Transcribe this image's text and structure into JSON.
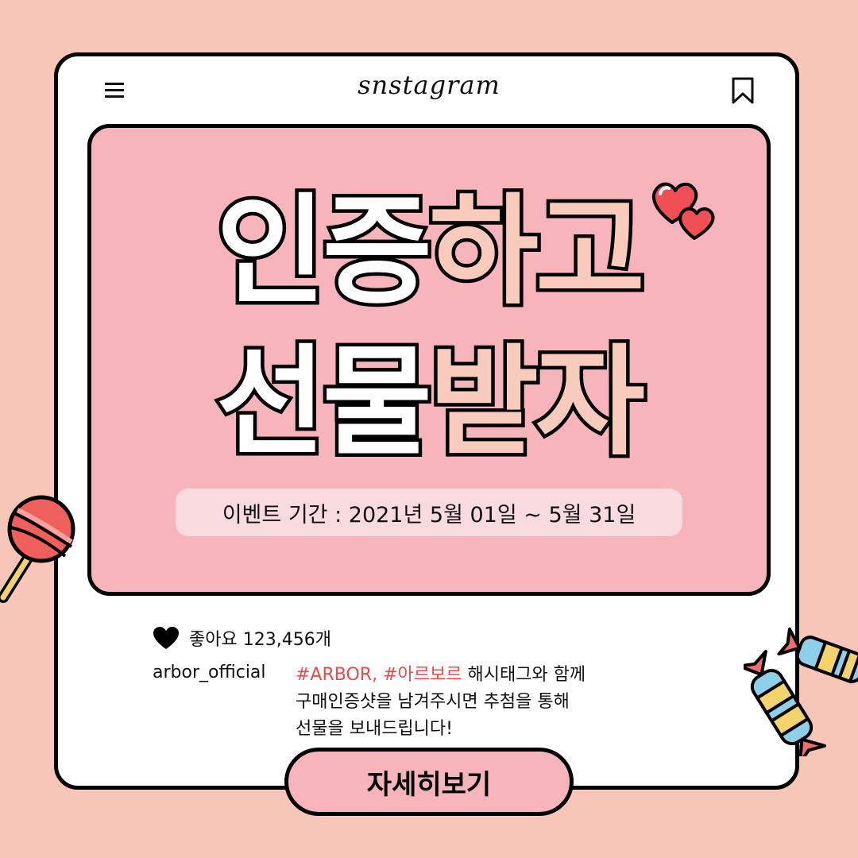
{
  "header": {
    "logo": "snstagram",
    "menu_icon": "hamburger-menu-icon",
    "bookmark_icon": "bookmark-icon"
  },
  "banner": {
    "line1_white": "인증",
    "line1_pink": "하고",
    "line2_white": "선물",
    "line2_pink": "받자",
    "period": "이벤트 기간 : 2021년 5월 01일 ~ 5월 31일"
  },
  "post": {
    "likes": "좋아요 123,456개",
    "username": "arbor_official",
    "caption_tags": "#ARBOR, #아르보르",
    "caption_line1_rest": " 해시태그와 함께",
    "caption_line2": "구매인증샷을 남겨주시면 추첨을 통해",
    "caption_line3": "선물을 보내드립니다!"
  },
  "cta": {
    "label": "자세히보기"
  },
  "colors": {
    "background": "#f8c6b9",
    "banner": "#f7b4ba",
    "headline_pink": "#f9cbbd",
    "hashtag": "#ea4a4d",
    "heart": "#ef4f55"
  }
}
